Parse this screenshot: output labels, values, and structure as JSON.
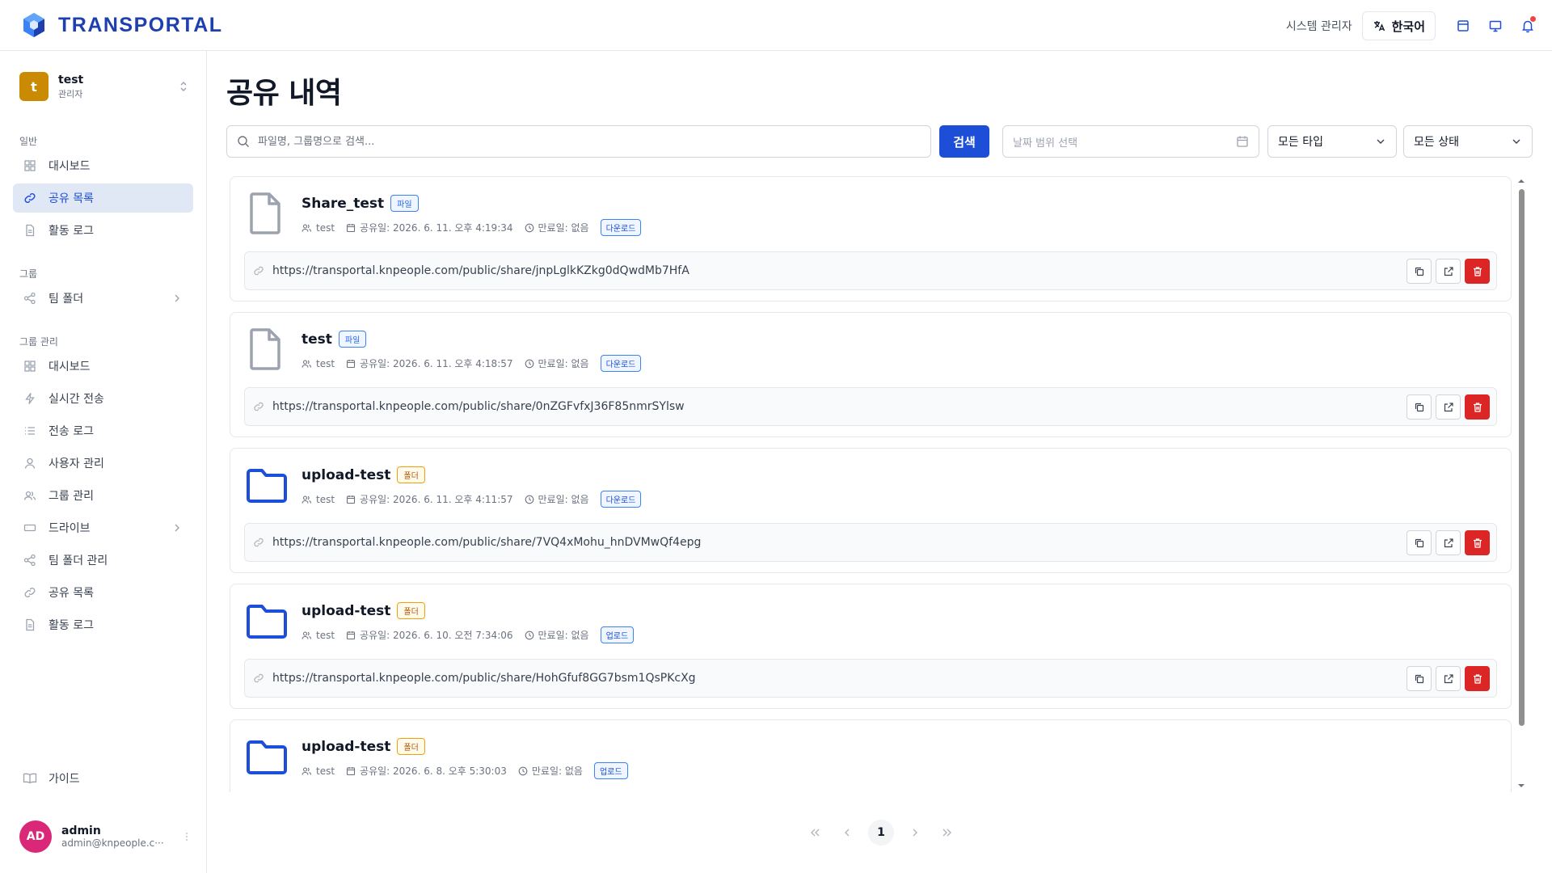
{
  "header": {
    "brand": "TRANSPORTAL",
    "role_label": "시스템 관리자",
    "language": "한국어",
    "icons": [
      "layout-icon",
      "monitor-icon",
      "bell-icon"
    ]
  },
  "sidebar": {
    "user": {
      "initial": "t",
      "name": "test",
      "role": "관리자"
    },
    "section_general": "일반",
    "general_items": [
      {
        "label": "대시보드",
        "icon": "grid-icon"
      },
      {
        "label": "공유 목록",
        "icon": "link-icon",
        "active": true
      },
      {
        "label": "활동 로그",
        "icon": "document-icon"
      }
    ],
    "section_group": "그룹",
    "group_items": [
      {
        "label": "팀 폴더",
        "icon": "share-nodes-icon"
      }
    ],
    "section_group_admin": "그룹 관리",
    "admin_items": [
      {
        "label": "대시보드",
        "icon": "grid-icon"
      },
      {
        "label": "실시간 전송",
        "icon": "lightning-icon"
      },
      {
        "label": "전송 로그",
        "icon": "list-icon"
      },
      {
        "label": "사용자 관리",
        "icon": "user-icon"
      },
      {
        "label": "그룹 관리",
        "icon": "users-icon"
      },
      {
        "label": "드라이브",
        "icon": "drive-icon"
      },
      {
        "label": "팀 폴더 관리",
        "icon": "share-nodes-icon"
      },
      {
        "label": "공유 목록",
        "icon": "link-icon"
      },
      {
        "label": "활동 로그",
        "icon": "document-icon"
      }
    ],
    "guide_label": "가이드",
    "bottom_user": {
      "initials": "AD",
      "name": "admin",
      "email": "admin@knpeople.c···"
    }
  },
  "main": {
    "title": "공유 내역",
    "search_placeholder": "파일명, 그룹명으로 검색...",
    "search_button": "검색",
    "date_placeholder": "날짜 범위 선택",
    "type_filter": "모든 타입",
    "status_filter": "모든 상태"
  },
  "shares": [
    {
      "name": "Share_test",
      "kind": "file",
      "type_label": "파일",
      "owner": "test",
      "shared": "공유일: 2026. 6. 11. 오후 4:19:34",
      "expires": "만료일: 없음",
      "permission": "다운로드",
      "url": "https://transportal.knpeople.com/public/share/jnpLglkKZkg0dQwdMb7HfA"
    },
    {
      "name": "test",
      "kind": "file",
      "type_label": "파일",
      "owner": "test",
      "shared": "공유일: 2026. 6. 11. 오후 4:18:57",
      "expires": "만료일: 없음",
      "permission": "다운로드",
      "url": "https://transportal.knpeople.com/public/share/0nZGFvfxJ36F85nmrSYlsw"
    },
    {
      "name": "upload-test",
      "kind": "folder",
      "type_label": "폴더",
      "owner": "test",
      "shared": "공유일: 2026. 6. 11. 오후 4:11:57",
      "expires": "만료일: 없음",
      "permission": "다운로드",
      "url": "https://transportal.knpeople.com/public/share/7VQ4xMohu_hnDVMwQf4epg"
    },
    {
      "name": "upload-test",
      "kind": "folder",
      "type_label": "폴더",
      "owner": "test",
      "shared": "공유일: 2026. 6. 10. 오전 7:34:06",
      "expires": "만료일: 없음",
      "permission": "업로드",
      "url": "https://transportal.knpeople.com/public/share/HohGfuf8GG7bsm1QsPKcXg"
    },
    {
      "name": "upload-test",
      "kind": "folder",
      "type_label": "폴더",
      "owner": "test",
      "shared": "공유일: 2026. 6. 8. 오후 5:30:03",
      "expires": "만료일: 없음",
      "permission": "업로드",
      "url": ""
    }
  ],
  "pagination": {
    "current_page": "1"
  },
  "colors": {
    "primary": "#1d4ed8",
    "danger": "#dc2626",
    "active_bg": "#e0e7f5",
    "avatar_t": "#ca8a04",
    "avatar_ad": "#db2777",
    "folder": "#1d4ed8"
  }
}
